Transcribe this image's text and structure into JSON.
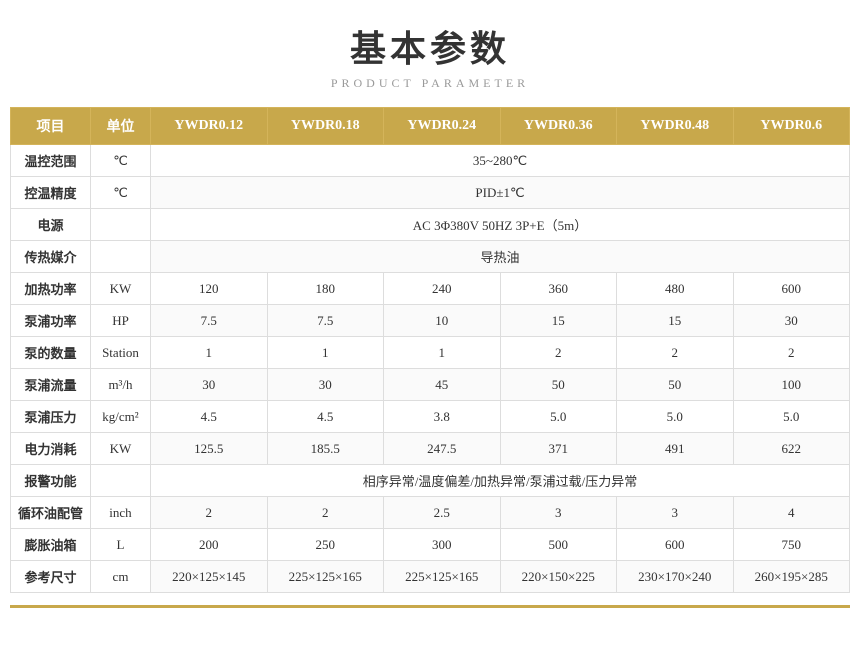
{
  "title": "基本参数",
  "subtitle": "PRODUCT PARAMETER",
  "table": {
    "headers": [
      "项目",
      "单位",
      "YWDR0.12",
      "YWDR0.18",
      "YWDR0.24",
      "YWDR0.36",
      "YWDR0.48",
      "YWDR0.6"
    ],
    "rows": [
      {
        "item": "温控范围",
        "unit": "℃",
        "span": true,
        "spanValue": "35~280℃"
      },
      {
        "item": "控温精度",
        "unit": "℃",
        "span": true,
        "spanValue": "PID±1℃"
      },
      {
        "item": "电源",
        "unit": "",
        "span": true,
        "spanValue": "AC 3Φ380V 50HZ 3P+E（5m）"
      },
      {
        "item": "传热媒介",
        "unit": "",
        "span": true,
        "spanValue": "导热油"
      },
      {
        "item": "加热功率",
        "unit": "KW",
        "span": false,
        "values": [
          "120",
          "180",
          "240",
          "360",
          "480",
          "600"
        ]
      },
      {
        "item": "泵浦功率",
        "unit": "HP",
        "span": false,
        "values": [
          "7.5",
          "7.5",
          "10",
          "15",
          "15",
          "30"
        ]
      },
      {
        "item": "泵的数量",
        "unit": "Station",
        "span": false,
        "values": [
          "1",
          "1",
          "1",
          "2",
          "2",
          "2"
        ]
      },
      {
        "item": "泵浦流量",
        "unit": "m³/h",
        "span": false,
        "values": [
          "30",
          "30",
          "45",
          "50",
          "50",
          "100"
        ]
      },
      {
        "item": "泵浦压力",
        "unit": "kg/cm²",
        "span": false,
        "values": [
          "4.5",
          "4.5",
          "3.8",
          "5.0",
          "5.0",
          "5.0"
        ]
      },
      {
        "item": "电力消耗",
        "unit": "KW",
        "span": false,
        "values": [
          "125.5",
          "185.5",
          "247.5",
          "371",
          "491",
          "622"
        ]
      },
      {
        "item": "报警功能",
        "unit": "",
        "span": true,
        "spanValue": "相序异常/温度偏差/加热异常/泵浦过载/压力异常"
      },
      {
        "item": "循环油配管",
        "unit": "inch",
        "span": false,
        "values": [
          "2",
          "2",
          "2.5",
          "3",
          "3",
          "4"
        ]
      },
      {
        "item": "膨胀油箱",
        "unit": "L",
        "span": false,
        "values": [
          "200",
          "250",
          "300",
          "500",
          "600",
          "750"
        ]
      },
      {
        "item": "参考尺寸",
        "unit": "cm",
        "span": false,
        "values": [
          "220×125×145",
          "225×125×165",
          "225×125×165",
          "220×150×225",
          "230×170×240",
          "260×195×285"
        ]
      }
    ]
  }
}
